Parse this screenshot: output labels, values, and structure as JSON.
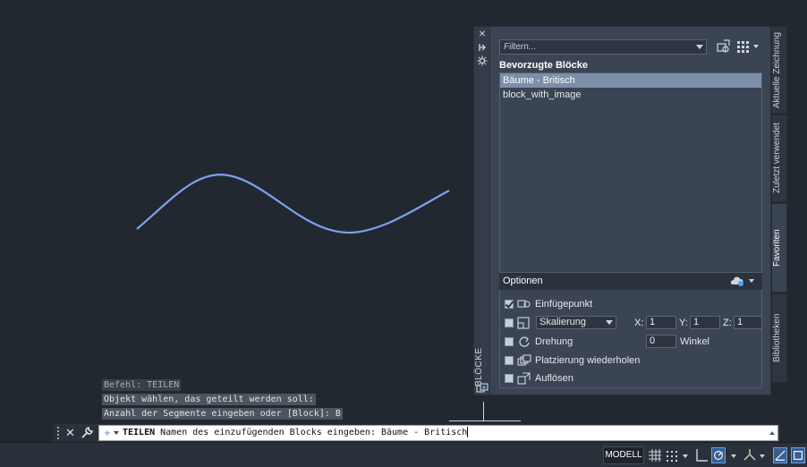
{
  "palette": {
    "vertical_title": "BLÖCKE",
    "filter_placeholder": "Filtern...",
    "section_title": "Bevorzugte Blöcke",
    "items": [
      {
        "label": "Bäume - Britisch",
        "selected": true
      },
      {
        "label": "block_with_image",
        "selected": false
      }
    ],
    "options": {
      "header": "Optionen",
      "insertion_point": {
        "label": "Einfügepunkt",
        "checked": true
      },
      "scale": {
        "select_value": "Skalierung",
        "checked": false,
        "x_label": "X:",
        "x_value": "1",
        "y_label": "Y:",
        "y_value": "1",
        "z_label": "Z:",
        "z_value": "1"
      },
      "rotation": {
        "label": "Drehung",
        "checked": false,
        "angle_value": "0",
        "angle_unit": "Winkel"
      },
      "repeat_placement": {
        "label": "Platzierung wiederholen",
        "checked": false
      },
      "explode": {
        "label": "Auflösen",
        "checked": false
      }
    }
  },
  "tabs": [
    {
      "label": "Aktuelle Zeichnung",
      "active": false
    },
    {
      "label": "Zuletzt verwendet",
      "active": false
    },
    {
      "label": "Favoriten",
      "active": true
    },
    {
      "label": "Bibliotheken",
      "active": false
    }
  ],
  "command_history": [
    "Befehl: TEILEN",
    "Objekt wählen, das geteilt werden soll:",
    "Anzahl der Segmente eingeben oder [Block]: B"
  ],
  "command_line": {
    "command_name": "TEILEN",
    "prompt_text": " Namen des einzufügenden Blocks eingeben: Bäume - Britisch"
  },
  "status_bar": {
    "model_label": "MODELL"
  },
  "colors": {
    "canvas_bg": "#212830",
    "curve": "#7fa0f0",
    "palette_bg": "#3b4453",
    "selected_item": "#7d8ea8"
  }
}
